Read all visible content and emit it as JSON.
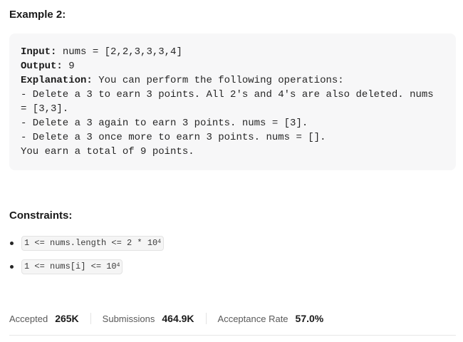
{
  "example": {
    "title": "Example 2:",
    "input_label": "Input:",
    "input_value": " nums = [2,2,3,3,3,4]",
    "output_label": "Output:",
    "output_value": " 9",
    "explanation_label": "Explanation:",
    "explanation_value": " You can perform the following operations:",
    "lines": [
      "- Delete a 3 to earn 3 points. All 2's and 4's are also deleted. nums",
      "= [3,3].",
      "- Delete a 3 again to earn 3 points. nums = [3].",
      "- Delete a 3 once more to earn 3 points. nums = [].",
      "You earn a total of 9 points."
    ]
  },
  "constraints": {
    "title": "Constraints:",
    "items": [
      {
        "text": "1 <= nums.length <= 2 * 10",
        "sup": "4"
      },
      {
        "text": "1 <= nums[i] <= 10",
        "sup": "4"
      }
    ]
  },
  "stats": {
    "accepted_label": "Accepted",
    "accepted_value": "265K",
    "submissions_label": "Submissions",
    "submissions_value": "464.9K",
    "acceptance_label": "Acceptance Rate",
    "acceptance_value": "57.0%"
  }
}
